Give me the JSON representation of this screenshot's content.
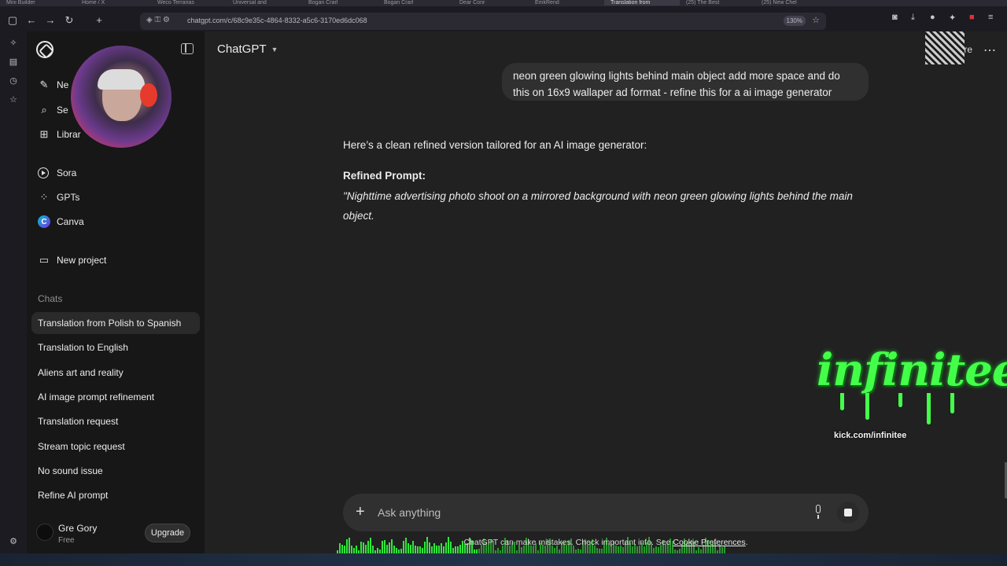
{
  "browser": {
    "tabs": [
      "Mini Builder",
      "Home / X",
      "Weco Terrarias",
      "Universal and",
      "Bogan Crarl",
      "Bogan Crarl",
      "Dear Conr",
      "EmkRend",
      "Translation from",
      "(25) The Best",
      "(25) New Chel"
    ],
    "url": "chatgpt.com/c/68c9e35c-4864-8332-a5c6-3170ed6dc068",
    "zoom": "130%"
  },
  "sidebar": {
    "top_items": [
      {
        "label": "Ne",
        "icon": "edit-icon"
      },
      {
        "label": "Se",
        "icon": "search-icon"
      },
      {
        "label": "Librar",
        "icon": "library-icon"
      }
    ],
    "apps": [
      {
        "label": "Sora"
      },
      {
        "label": "GPTs"
      },
      {
        "label": "Canva",
        "glyph": "C"
      }
    ],
    "new_project": "New project",
    "chats_label": "Chats",
    "chats": [
      "Translation from Polish to Spanish",
      "Translation to English",
      "Aliens art and reality",
      "AI image prompt refinement",
      "Translation request",
      "Stream topic request",
      "No sound issue",
      "Refine AI prompt"
    ],
    "user": {
      "name": "Gre Gory",
      "plan": "Free",
      "upgrade": "Upgrade"
    }
  },
  "header": {
    "model": "ChatGPT",
    "share_fragment": "re"
  },
  "conversation": {
    "user_message": "neon green glowing lights behind main object add more space and do this on 16x9 wallaper ad format - refine this for a ai image generator",
    "reply_intro": "Here’s a clean refined version tailored for an AI image generator:",
    "reply_heading": "Refined Prompt:",
    "reply_body": "\"Nighttime advertising photo shoot on a mirrored background with neon green glowing lights behind the main object."
  },
  "overlay": {
    "brand": "infinitee",
    "brand_url": "kick.com/infinitee"
  },
  "composer": {
    "placeholder": "Ask anything",
    "disclaimer": "ChatGPT can make mistakes. Check important info. See",
    "disclaimer_link": "Cookie Preferences",
    "disclaimer_end": "."
  },
  "colors": {
    "background": "#212121",
    "sidebar": "#171717",
    "bubble": "#303030",
    "brand_green": "#44ff4a"
  }
}
